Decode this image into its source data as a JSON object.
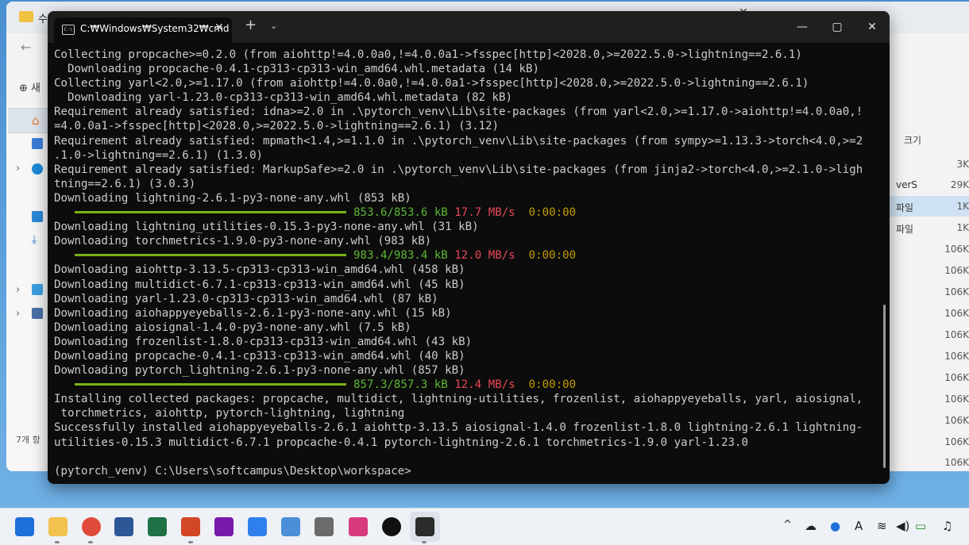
{
  "terminal": {
    "tab_title": "C:₩Windows₩System32₩cmd",
    "tab_icon_text": "C:\\",
    "new_tab": "+",
    "dropdown": "⌄",
    "minimize": "—",
    "maximize": "▢",
    "close": "✕",
    "lines": [
      {
        "text": "Collecting propcache>=0.2.0 (from aiohttp!=4.0.0a0,!=4.0.0a1->fsspec[http]<2028.0,>=2022.5.0->lightning==2.6.1)"
      },
      {
        "text": "  Downloading propcache-0.4.1-cp313-cp313-win_amd64.whl.metadata (14 kB)"
      },
      {
        "text": "Collecting yarl<2.0,>=1.17.0 (from aiohttp!=4.0.0a0,!=4.0.0a1->fsspec[http]<2028.0,>=2022.5.0->lightning==2.6.1)"
      },
      {
        "text": "  Downloading yarl-1.23.0-cp313-cp313-win_amd64.whl.metadata (82 kB)"
      },
      {
        "text": "Requirement already satisfied: idna>=2.0 in .\\pytorch_venv\\Lib\\site-packages (from yarl<2.0,>=1.17.0->aiohttp!=4.0.0a0,!"
      },
      {
        "text": "=4.0.0a1->fsspec[http]<2028.0,>=2022.5.0->lightning==2.6.1) (3.12)"
      },
      {
        "text": "Requirement already satisfied: mpmath<1.4,>=1.1.0 in .\\pytorch_venv\\Lib\\site-packages (from sympy>=1.13.3->torch<4.0,>=2"
      },
      {
        "text": ".1.0->lightning==2.6.1) (1.3.0)"
      },
      {
        "text": "Requirement already satisfied: MarkupSafe>=2.0 in .\\pytorch_venv\\Lib\\site-packages (from jinja2->torch<4.0,>=2.1.0->ligh"
      },
      {
        "text": "tning==2.6.1) (3.0.3)"
      },
      {
        "text": "Downloading lightning-2.6.1-py3-none-any.whl (853 kB)"
      },
      {
        "progress": {
          "size": "853.6/853.6 kB",
          "speed": "17.7 MB/s",
          "eta": "0:00:00"
        }
      },
      {
        "text": "Downloading lightning_utilities-0.15.3-py3-none-any.whl (31 kB)"
      },
      {
        "text": "Downloading torchmetrics-1.9.0-py3-none-any.whl (983 kB)"
      },
      {
        "progress": {
          "size": "983.4/983.4 kB",
          "speed": "12.0 MB/s",
          "eta": "0:00:00"
        }
      },
      {
        "text": "Downloading aiohttp-3.13.5-cp313-cp313-win_amd64.whl (458 kB)"
      },
      {
        "text": "Downloading multidict-6.7.1-cp313-cp313-win_amd64.whl (45 kB)"
      },
      {
        "text": "Downloading yarl-1.23.0-cp313-cp313-win_amd64.whl (87 kB)"
      },
      {
        "text": "Downloading aiohappyeyeballs-2.6.1-py3-none-any.whl (15 kB)"
      },
      {
        "text": "Downloading aiosignal-1.4.0-py3-none-any.whl (7.5 kB)"
      },
      {
        "text": "Downloading frozenlist-1.8.0-cp313-cp313-win_amd64.whl (43 kB)"
      },
      {
        "text": "Downloading propcache-0.4.1-cp313-cp313-win_amd64.whl (40 kB)"
      },
      {
        "text": "Downloading pytorch_lightning-2.6.1-py3-none-any.whl (857 kB)"
      },
      {
        "progress": {
          "size": "857.3/857.3 kB",
          "speed": "12.4 MB/s",
          "eta": "0:00:00"
        }
      },
      {
        "text": "Installing collected packages: propcache, multidict, lightning-utilities, frozenlist, aiohappyeyeballs, yarl, aiosignal,"
      },
      {
        "text": " torchmetrics, aiohttp, pytorch-lightning, lightning"
      },
      {
        "text": "Successfully installed aiohappyeyeballs-2.6.1 aiohttp-3.13.5 aiosignal-1.4.0 frozenlist-1.8.0 lightning-2.6.1 lightning-"
      },
      {
        "text": "utilities-0.15.3 multidict-6.7.1 propcache-0.4.1 pytorch-lightning-2.6.1 torchmetrics-1.9.0 yarl-1.23.0"
      },
      {
        "text": ""
      },
      {
        "text": "(pytorch_venv) C:\\Users\\softcampus\\Desktop\\workspace>"
      }
    ],
    "colors": {
      "bar": "#7ab317",
      "size": "#5cb832",
      "speed": "#e74856",
      "eta": "#c19c00",
      "background": "#0c0c0c"
    }
  },
  "explorer": {
    "tab_label": "수",
    "new_label": "새",
    "count_label": "7개 항",
    "column_header": "크기",
    "rows": [
      {
        "name": "",
        "size": "3K"
      },
      {
        "name": "verS",
        "size": "29K"
      },
      {
        "name": "파일",
        "size": "1K"
      },
      {
        "name": "파일",
        "size": "1K"
      },
      {
        "name": "",
        "size": "106K"
      },
      {
        "name": "",
        "size": "106K"
      },
      {
        "name": "",
        "size": "106K"
      },
      {
        "name": "",
        "size": "106K"
      },
      {
        "name": "",
        "size": "106K"
      },
      {
        "name": "",
        "size": "106K"
      },
      {
        "name": "",
        "size": "106K"
      },
      {
        "name": "",
        "size": "106K"
      },
      {
        "name": "",
        "size": "106K"
      },
      {
        "name": "",
        "size": "106K"
      },
      {
        "name": "",
        "size": "106K"
      }
    ]
  },
  "taskbar": {
    "apps": [
      "start-icon",
      "file-explorer-icon",
      "chrome-icon",
      "word-icon",
      "excel-icon",
      "powerpoint-icon",
      "onenote-icon",
      "vscode-icon",
      "notepad-icon",
      "calculator-icon",
      "snipping-tool-icon",
      "github-icon",
      "terminal-icon"
    ],
    "tray": {
      "chevron": "^",
      "keyboard": "A"
    }
  }
}
